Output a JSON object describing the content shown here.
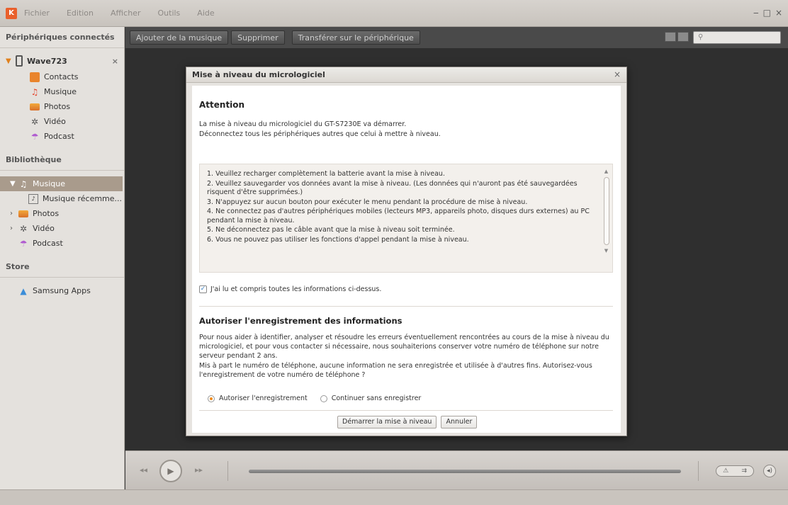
{
  "menubar": {
    "items": [
      "Fichier",
      "Edition",
      "Afficher",
      "Outils",
      "Aide"
    ]
  },
  "sidebar": {
    "connected_header": "Périphériques connectés",
    "device_name": "Wave723",
    "device_items": [
      "Contacts",
      "Musique",
      "Photos",
      "Vidéo",
      "Podcast"
    ],
    "library_header": "Bibliothèque",
    "library_items": [
      "Musique",
      "Musique récemme...",
      "Photos",
      "Vidéo",
      "Podcast"
    ],
    "store_header": "Store",
    "store_items": [
      "Samsung Apps"
    ]
  },
  "toolbar": {
    "add_music": "Ajouter de la musique",
    "delete": "Supprimer",
    "transfer": "Transférer sur le périphérique"
  },
  "dialog": {
    "title": "Mise à niveau du micrologiciel",
    "attention_heading": "Attention",
    "intro_lines": [
      "La mise à niveau du micrologiciel du GT-S7230E va démarrer.",
      "Déconnectez tous les périphériques autres que celui à mettre à niveau."
    ],
    "instructions": [
      "1. Veuillez recharger complètement la batterie avant la mise à niveau.",
      "2. Veuillez sauvegarder vos données avant la mise à niveau. (Les données qui n'auront pas été sauvegardées risquent d'être supprimées.)",
      "3. N'appuyez sur aucun bouton pour exécuter le menu pendant la procédure de mise à niveau.",
      "4. Ne connectez pas d'autres périphériques mobiles (lecteurs MP3, appareils photo, disques durs externes) au PC pendant la mise à niveau.",
      "5. Ne déconnectez pas le câble avant que la mise à niveau soit terminée.",
      "6. Vous ne pouvez pas utiliser les fonctions d'appel pendant la mise à niveau."
    ],
    "understood_checkbox": "J'ai lu et compris toutes les informations ci-dessus.",
    "understood_checked": true,
    "registration_heading": "Autoriser l'enregistrement des informations",
    "registration_text": "Pour nous aider à identifier, analyser et résoudre les erreurs éventuellement rencontrées au cours de la mise à niveau du micrologiciel, et pour vous contacter si nécessaire, nous souhaiterions conserver votre numéro de téléphone sur notre serveur pendant 2 ans.",
    "registration_text2": "Mis à part le numéro de téléphone, aucune information ne sera enregistrée et utilisée à d'autres fins. Autorisez-vous l'enregistrement de votre numéro de téléphone ?",
    "option_allow": "Autoriser l'enregistrement",
    "option_skip": "Continuer sans enregistrer",
    "selected_option": "allow",
    "start_button": "Démarrer la mise à niveau",
    "cancel_button": "Annuler"
  },
  "colors": {
    "accent": "#f08a1c",
    "selection": "#a99b8c"
  }
}
